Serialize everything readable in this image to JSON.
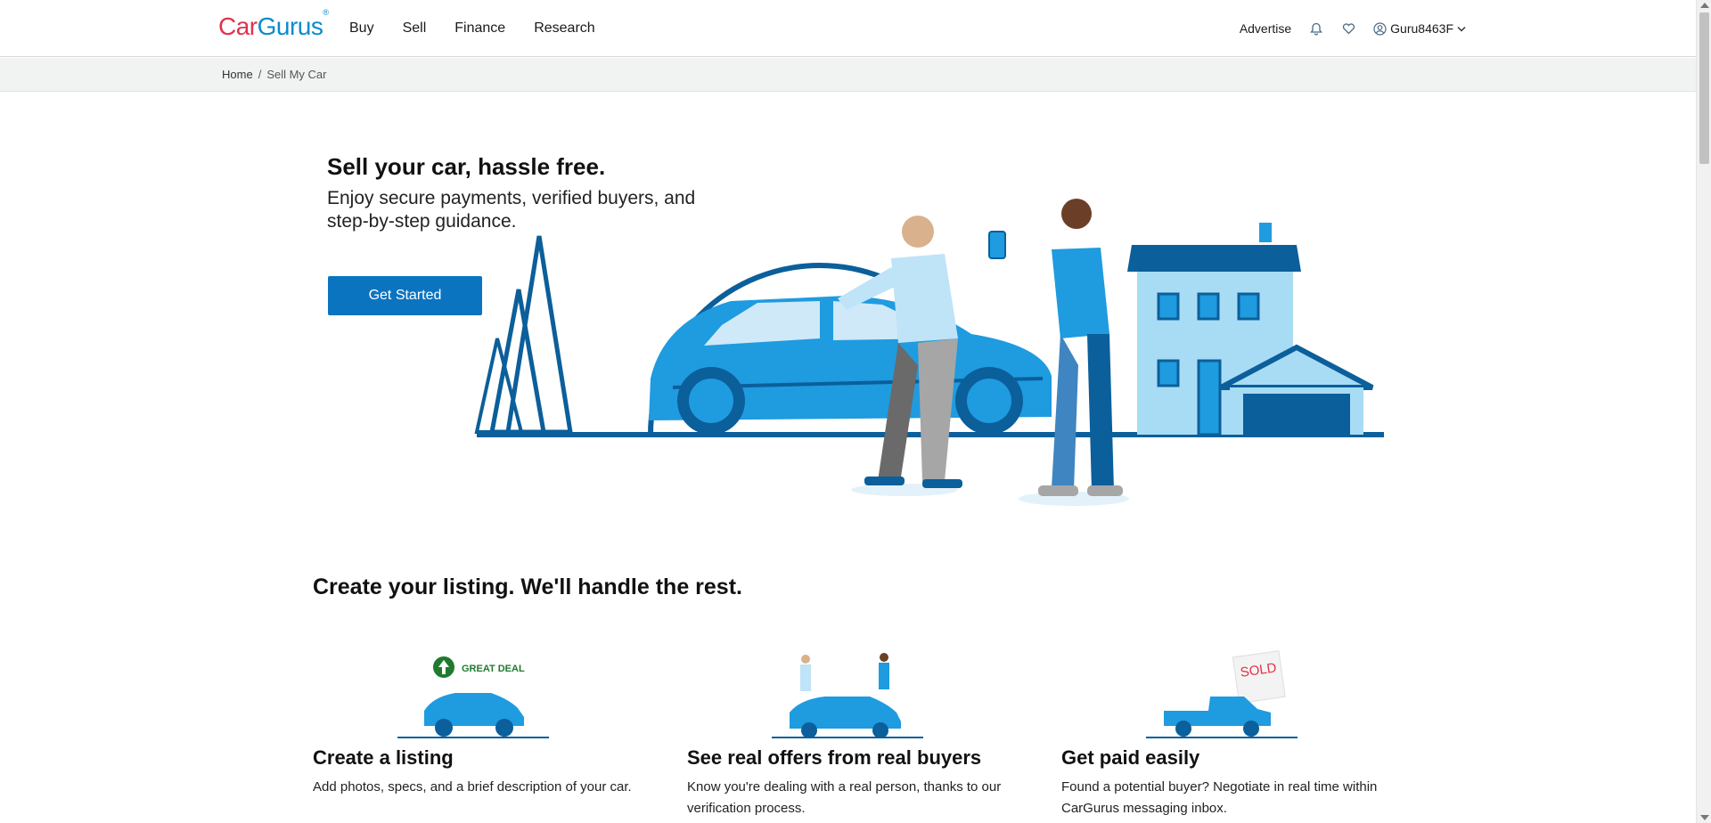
{
  "header": {
    "logo_car": "Car",
    "logo_gurus": "Gurus",
    "logo_mark": "®",
    "nav": [
      "Buy",
      "Sell",
      "Finance",
      "Research"
    ],
    "advertise": "Advertise",
    "username": "Guru8463F",
    "icons": [
      "bell-icon",
      "heart-icon",
      "user-circle-icon",
      "chevron-down-icon"
    ]
  },
  "breadcrumb": {
    "home": "Home",
    "separator": "/",
    "current": "Sell My Car"
  },
  "hero": {
    "title": "Sell your car, hassle free.",
    "subtitle": "Enjoy secure payments, verified buyers, and step-by-step guidance.",
    "cta": "Get Started"
  },
  "section": {
    "title": "Create your listing. We'll handle the rest.",
    "steps": [
      {
        "title": "Create a listing",
        "text": "Add photos, specs, and a brief description of your car.",
        "badge": "GREAT DEAL"
      },
      {
        "title": "See real offers from real buyers",
        "text": "Know you're dealing with a real person, thanks to our verification process."
      },
      {
        "title": "Get paid easily",
        "text": "Found a potential buyer? Negotiate in real time within CarGurus messaging inbox.",
        "badge": "SOLD"
      }
    ]
  },
  "colors": {
    "brand_red": "#e0324b",
    "brand_blue": "#0a8bcc",
    "primary_button": "#0b74c0",
    "illustration_blue": "#1f9be0",
    "illustration_dark": "#0b5f9a",
    "great_deal_green": "#1f7a2e"
  }
}
